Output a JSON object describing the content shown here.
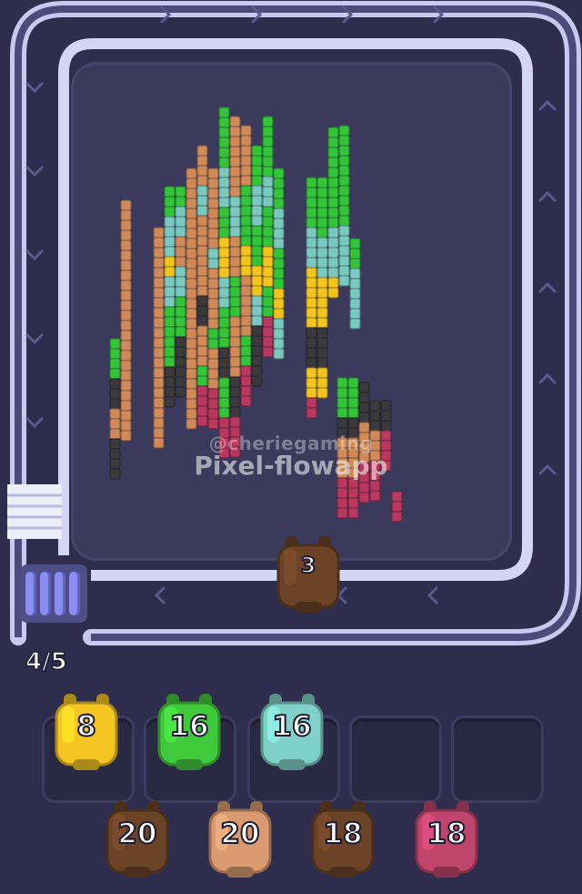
{
  "hud": {
    "queue_count": "4/5"
  },
  "shooter": {
    "count": "3",
    "color": "#6b4326"
  },
  "slots": [
    {
      "count": "8",
      "color": "#f5c521"
    },
    {
      "count": "16",
      "color": "#41c93c"
    },
    {
      "count": "16",
      "color": "#7fd0c6"
    },
    {
      "count": "",
      "color": ""
    },
    {
      "count": "",
      "color": ""
    }
  ],
  "queue": [
    {
      "count": "20",
      "color": "#6b4326"
    },
    {
      "count": "20",
      "color": "#d89a6e"
    },
    {
      "count": "18",
      "color": "#6b4326"
    },
    {
      "count": "18",
      "color": "#c0456d"
    }
  ],
  "watermark": {
    "handle": "@cheriegaming",
    "app": "Pixel-flowapp"
  },
  "palette": {
    "tan": "#d08a5a",
    "green": "#33c43a",
    "lightgreen": "#55e04a",
    "teal": "#79c9c0",
    "yellow": "#f3c41e",
    "dark": "#3a3a3e",
    "pink": "#b8385f",
    "brown": "#5e3d28"
  }
}
